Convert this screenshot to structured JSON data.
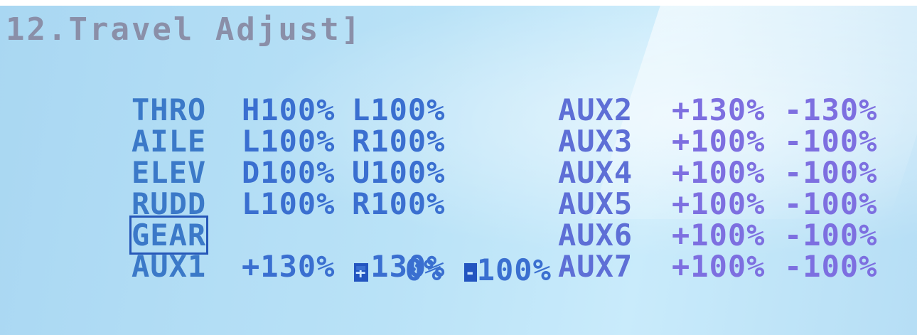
{
  "screen": {
    "title": "12.Travel Adjust]"
  },
  "left_channels": [
    {
      "name": "THRO",
      "a": "H100%",
      "b": "L100%"
    },
    {
      "name": "AILE",
      "a": "L100%",
      "b": "R100%"
    },
    {
      "name": "ELEV",
      "a": "D100%",
      "b": "U100%"
    },
    {
      "name": "RUDD",
      "a": "L100%",
      "b": "R100%"
    },
    {
      "name": "GEAR",
      "a_sign": "+",
      "a": "0%",
      "b_sign": "-",
      "b": "100%"
    },
    {
      "name": "AUX1",
      "a": "+130%",
      "b": "-130%"
    }
  ],
  "right_channels": [
    {
      "name": "AUX2",
      "a": "+130%",
      "b": "-130%"
    },
    {
      "name": "AUX3",
      "a": "+100%",
      "b": "-100%"
    },
    {
      "name": "AUX4",
      "a": "+100%",
      "b": "-100%"
    },
    {
      "name": "AUX5",
      "a": "+100%",
      "b": "-100%"
    },
    {
      "name": "AUX6",
      "a": "+100%",
      "b": "-100%"
    },
    {
      "name": "AUX7",
      "a": "+100%",
      "b": "-100%"
    }
  ],
  "selected_channel": "GEAR"
}
